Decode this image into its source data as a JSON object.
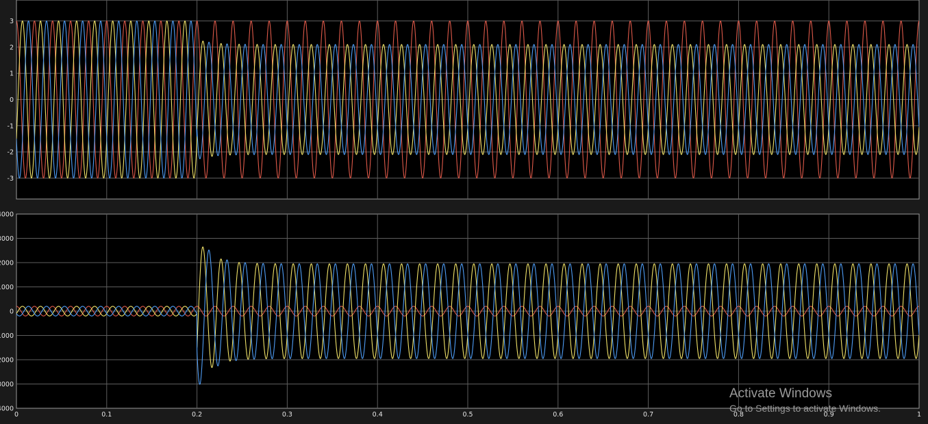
{
  "chart_data": [
    {
      "type": "line",
      "title": "",
      "xlabel": "",
      "ylabel": "",
      "xlim": [
        0,
        1
      ],
      "ylim": [
        -3.8,
        3.8
      ],
      "y_ticks": [
        -3,
        -2,
        -1,
        0,
        1,
        2,
        3
      ],
      "y_tick_labels": [
        "-3",
        "-2",
        "-1",
        "0",
        "1",
        "2",
        "3"
      ],
      "x_ticks": [
        0,
        0.1,
        0.2,
        0.3,
        0.4,
        0.5,
        0.6,
        0.7,
        0.8,
        0.9,
        1
      ],
      "x_tick_labels": [],
      "grid": true,
      "background": "#000000",
      "series": [
        {
          "color": "#e05a4a",
          "frequency_hz": 50,
          "phase_deg": 90,
          "amplitude_before": 3,
          "amplitude_after": 3,
          "transient_peak": 3,
          "event_time": 0.2
        },
        {
          "color": "#f2e46a",
          "frequency_hz": 50,
          "phase_deg": -30,
          "amplitude_before": 3,
          "amplitude_after": 2.1,
          "transient_peak": 2.3,
          "event_time": 0.2
        },
        {
          "color": "#4f9ef7",
          "frequency_hz": 50,
          "phase_deg": 210,
          "amplitude_before": 3,
          "amplitude_after": 2.1,
          "transient_peak": 2.3,
          "event_time": 0.2
        }
      ]
    },
    {
      "type": "line",
      "title": "",
      "xlabel": "",
      "ylabel": "",
      "xlim": [
        0,
        1
      ],
      "ylim": [
        -4000,
        4000
      ],
      "y_ticks": [
        -4000,
        -3000,
        -2000,
        -1000,
        0,
        1000,
        2000,
        3000,
        4000
      ],
      "y_tick_labels": [
        "4000",
        "3000",
        "2000",
        "1000",
        "0",
        "1000",
        "2000",
        "3000",
        "4000"
      ],
      "x_ticks": [
        0,
        0.1,
        0.2,
        0.3,
        0.4,
        0.5,
        0.6,
        0.7,
        0.8,
        0.9,
        1
      ],
      "x_tick_labels": [
        "0",
        "0.1",
        "0.2",
        "0.3",
        "0.4",
        "0.5",
        "0.6",
        "0.7",
        "0.8",
        "0.9",
        "1"
      ],
      "grid": true,
      "background": "#000000",
      "series": [
        {
          "color": "#e05a4a",
          "frequency_hz": 50,
          "phase_deg": 90,
          "amplitude_before": 200,
          "amplitude_after": 200,
          "transient_peak": 200,
          "event_time": 0.2
        },
        {
          "color": "#f2e46a",
          "frequency_hz": 50,
          "phase_deg": -30,
          "amplitude_before": 200,
          "amplitude_after": 1950,
          "transient_peak": 3000,
          "event_time": 0.2
        },
        {
          "color": "#4f9ef7",
          "frequency_hz": 50,
          "phase_deg": 210,
          "amplitude_before": 200,
          "amplitude_after": 1950,
          "transient_peak": 3250,
          "event_time": 0.2
        }
      ]
    }
  ],
  "watermark": {
    "title": "Activate Windows",
    "subtitle": "Go to Settings to activate Windows."
  }
}
